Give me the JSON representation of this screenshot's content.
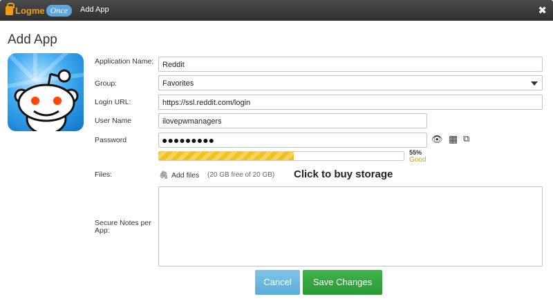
{
  "window": {
    "logo_text": "Logme",
    "logo_cloud_text": "Once",
    "title": "Add App",
    "close_icon": "close-icon"
  },
  "page": {
    "heading": "Add App"
  },
  "app_icon": {
    "name": "reddit-alien-icon"
  },
  "form": {
    "application_name": {
      "label": "Application Name:",
      "value": "Reddit"
    },
    "group": {
      "label": "Group:",
      "value": "Favorites"
    },
    "login_url": {
      "label": "Login URL:",
      "value": "https://ssl.reddit.com/login"
    },
    "user_name": {
      "label": "User Name",
      "value": "ilovepwmanagers"
    },
    "password": {
      "label": "Password",
      "masked_value": "●●●●●●●●●",
      "strength_percent": 55,
      "strength_percent_label": "55%",
      "strength_label": "Good"
    },
    "files": {
      "label": "Files:",
      "add_label": "Add files",
      "storage_text": "(20 GB free of 20 GB)",
      "buy_storage": "Click to buy storage"
    },
    "notes": {
      "label": "Secure Notes per App:",
      "value": ""
    }
  },
  "buttons": {
    "cancel": "Cancel",
    "save": "Save Changes"
  },
  "colors": {
    "titlebar": "#3a3a3a",
    "logo_orange": "#f39c12",
    "strength_yellow": "#f3c11d",
    "good_text": "#d4a017",
    "cancel_button": "#6cb9e0",
    "save_button": "#35a740"
  }
}
